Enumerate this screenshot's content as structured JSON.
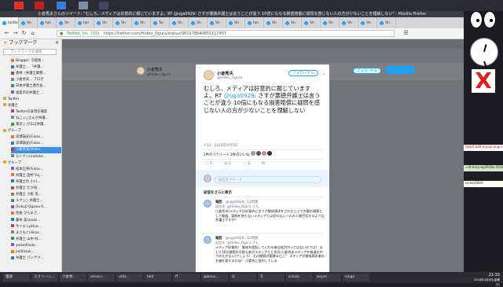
{
  "window": {
    "title": "小倉秀夫さんのツイート: \"むしろ、メディアは好意的に報じていますよ。RT @uga0929: さすが悪徳弁護士は言うことが違う 10倍にもなる損害賠償に疑問を感じない人の方が少ないことを理解しない\" - Mozilla Firefox"
  },
  "tabs": [
    "twitter",
    "Sh",
    "twi",
    "Sh",
    "twi",
    "Sh",
    "Sh",
    "Sh",
    "Tw",
    "Sh",
    "Sh",
    "Sh",
    "Sh",
    "twi",
    "Sh",
    "Sh",
    "Sh",
    "Sh",
    "Sh",
    "Sh",
    "Sh"
  ],
  "url": "https://twitter.com/Hideo_Ogura/status/981978840855117457",
  "url_prefix": "Twitter, Inc. (US)",
  "sidebar": {
    "title": "ブックマーク",
    "search_placeholder": "ブックマークを検索",
    "items": [
      "Blogger: 引越後...",
      "弁護士... 「弁護...",
      "香林（弁護士業務...",
      "小倉秀夫... ブログ",
      "日本弁護士連合会...",
      "福島市の弁護士 ...",
      "Twitter",
      "弁護士",
      "Twitterの表現を検索",
      "ねこ○○さんが弁護...",
      "東京○ びるば弁護...",
      "グループ",
      "深澤諭史(Fukas...",
      "深澤諭史(Fukas...",
      "小倉秀夫(Hideo...",
      "モトケン(motoke...",
      "グループ",
      "松本正男(Fukas...",
      "弁護士 田村 Yuj...",
      "弁護士の 小川...",
      "弁護士 たか坊...",
      "弁護士 小松 浩...",
      "ルク○○ 弁護士...",
      "[Fukuj] Ogawa R...",
      "佐伯 ひらまさ...",
      "藤本 美(azuki...",
      "サイエンpHua...",
      "まさもと(Hiros...",
      "弁護士 山中 M...",
      "yoike(Kisdo...",
      "Jal(Kazuk...",
      "弁護士 パンテク..."
    ],
    "selected_index": 14
  },
  "profile": {
    "name": "小倉秀夫",
    "handle": "@Hideo_Ogura",
    "follow_label": "フォローする"
  },
  "tweet": {
    "author": "小倉秀夫",
    "handle": "@Hideo_Ogura",
    "follow_label": "フォローする",
    "text_before": "むしろ、メディアは好意的に報じていますよ。RT ",
    "mention": "@uga0929",
    "text_after": ": さすが悪徳弁護士は言うことが違う 10倍にもなる損害賠償に疑問を感じない人の方が少ないことを理解しない",
    "timestamp": "3:10 - 2018年4月5日",
    "stats": "2件のリツイート  2件のいいね",
    "reply_count": "5",
    "retweet_count": "2",
    "like_count": "2",
    "reply_placeholder": "返信をツイート"
  },
  "replies_header": "返信をさらに表示",
  "replies": [
    {
      "author": "竜胆",
      "handle": "@uga0929 · 12時間",
      "reply_to": "返信先: @Hideo_Ogura さん",
      "text": "小倉秀夫(メディアは好意的に言うが懲戒請求をされたことでの懲の損害として報道、疑問を持たないメディアとは言わない一人の人間が否するような弁護士ですが？"
    },
    {
      "author": "竜胆",
      "handle": "@uga0929 · 12時間",
      "reply_to": "返信先: @Hideo_Ogura さん",
      "text": "メディア好意的？ 懲戒を提起してくれる者は批判がってはないのでは？ まして10の懲罰の可能な者がメディアだと非同 小倉秀夫メディアを報道の中での仕方ない(でしょう？ その懲罰の基礎はどこ？ メディアが懲戒請求者の名誉を保するかは？ 小倉秀に批判している"
    }
  ],
  "right_panel": {
    "term1": "~$ ssh ...",
    "term2": "tweet-add-myupl-ung.o",
    "term3": "~/d-ensy-ep2018u-2018/7",
    "term4": "screenShot"
  },
  "taskbar": {
    "tasks": [
      "電源",
      "スクリーン...",
      "小倉秀...",
      "emacs...",
      "utils...",
      "twit",
      "ff",
      "@beas...",
      "Q",
      "Tr",
      "sclock",
      "xeyes",
      "xlogo"
    ],
    "time": "21:33",
    "date": "2018年4月6日(金曜日)"
  },
  "colors": {
    "twitter_blue": "#1da1f2",
    "overlay": "#707377",
    "selected_bookmark": "#3d8ee6"
  }
}
